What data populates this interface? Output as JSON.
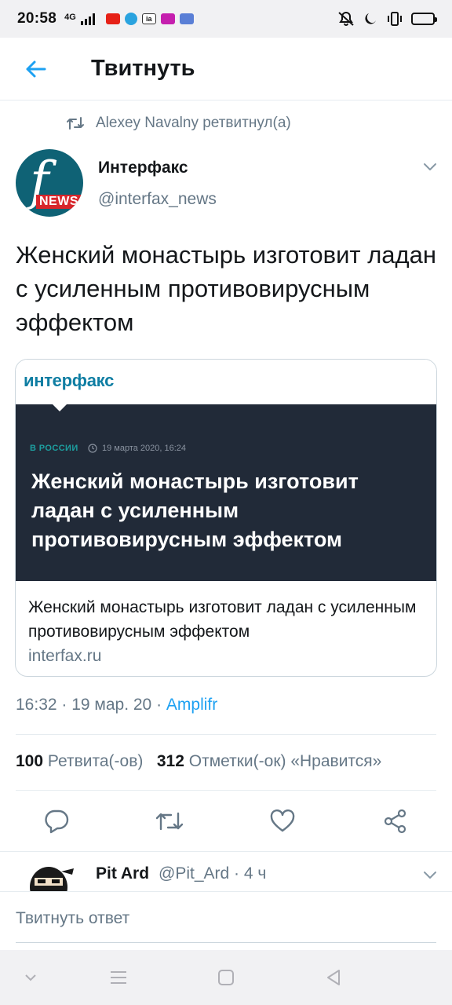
{
  "status_bar": {
    "time": "20:58",
    "network": "4G",
    "battery_color": "#f2c40c"
  },
  "header": {
    "title": "Твитнуть",
    "back_icon": "arrow-left-icon"
  },
  "retweet": {
    "label": "Alexey Navalny ретвитнул(а)"
  },
  "author": {
    "name": "Интерфакс",
    "handle": "@interfax_news",
    "avatar_letter": "f",
    "avatar_badge": "NEWS"
  },
  "tweet": {
    "text": "Женский монастырь изготовит ладан с усиленным противовирусным эффектом"
  },
  "card": {
    "logo": "интерфакс",
    "category": "В РОССИИ",
    "date": "19 марта 2020, 16:24",
    "headline": "Женский монастырь изготовит ладан с усиленным противовирусным эффектом",
    "title": "Женский монастырь изготовит ладан с усиленным противовирусным эффектом",
    "domain": "interfax.ru"
  },
  "meta": {
    "time": "16:32 · 19 мар. 20 · ",
    "source": "Amplifr"
  },
  "stats": {
    "retweets_count": "100",
    "retweets_label": "Ретвита(-ов)",
    "likes_count": "312",
    "likes_label": "Отметки(-ок) «Нравится»"
  },
  "reply": {
    "name": "Pit Ard",
    "meta": "@Pit_Ard · 4 ч"
  },
  "composer": {
    "placeholder": "Твитнуть ответ"
  },
  "colors": {
    "accent": "#1da1f2",
    "muted": "#657786",
    "card_image_bg": "#212a38"
  }
}
